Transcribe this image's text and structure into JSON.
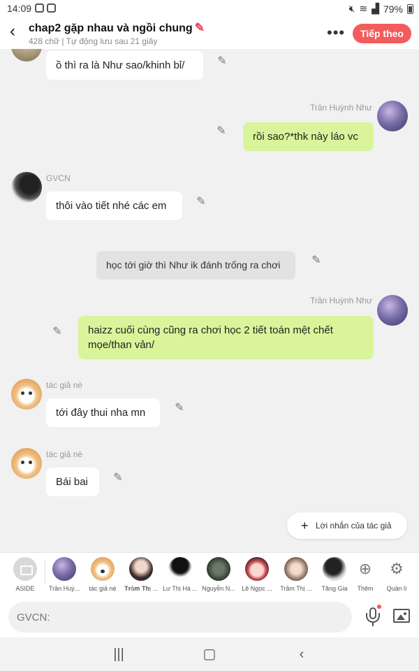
{
  "status_bar": {
    "time": "14:09",
    "battery": "79%"
  },
  "header": {
    "title": "chap2 gặp nhau và ngồi chung",
    "subtitle": "428 chữ | Tự động lưu sau 21 giây",
    "follow_label": "Tiếp theo"
  },
  "messages": [
    {
      "sender": "",
      "text": "ồ thì ra là Như sao/khinh bỉ/",
      "side": "left"
    },
    {
      "sender": "Trần Huỳnh Như",
      "text": "rồi sao?*thk này láo vc",
      "side": "right"
    },
    {
      "sender": "GVCN",
      "text": "thôi vào tiết nhé các em",
      "side": "left"
    },
    {
      "sender": "",
      "text": "học tới giờ thì Như ik đánh trống ra chơi",
      "side": "narration"
    },
    {
      "sender": "Trần Huỳnh Như",
      "text": "haizz cuối cùng cũng ra chơi học 2 tiết toán mệt chết mọe/than vản/",
      "side": "right"
    },
    {
      "sender": "tác giả nè",
      "text": "tới đây thui nha mn",
      "side": "left"
    },
    {
      "sender": "tác giả nè",
      "text": "Bái bai",
      "side": "left"
    }
  ],
  "author_note_label": "Lời nhắn của tác giả",
  "characters": [
    {
      "name": "ASIDE"
    },
    {
      "name": "Trần Huỳ..."
    },
    {
      "name": "tác giả nè"
    },
    {
      "name": "𝐓𝐫ầ𝐦 𝐓𝐡ị ..."
    },
    {
      "name": "Lư Thị Hà ..."
    },
    {
      "name": "Nguyễn N..."
    },
    {
      "name": "Lê Ngọc ..."
    },
    {
      "name": "Trầm Thị ..."
    },
    {
      "name": "Tăng Gia"
    }
  ],
  "tools": {
    "add_label": "Thêm",
    "manage_label": "Quản lí"
  },
  "input": {
    "placeholder": "GVCN:"
  }
}
